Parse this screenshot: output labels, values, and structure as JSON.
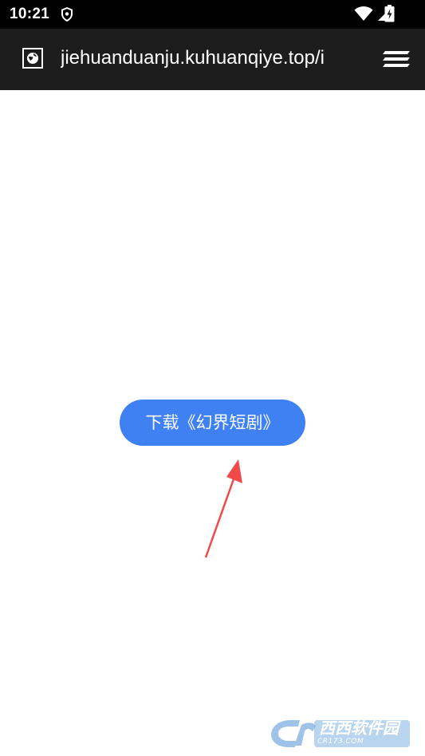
{
  "status_bar": {
    "time": "10:21",
    "icons": [
      "shield-icon",
      "wifi-icon",
      "signal-icon",
      "battery-charging-icon"
    ]
  },
  "browser": {
    "url": "jiehuanduanju.kuhuanqiye.top/i",
    "site_icon": "globe-icon",
    "menu_icon": "menu-icon"
  },
  "main": {
    "download_button_label": "下载《幻界短剧》",
    "annotation_arrow_color": "#f04a4a",
    "button_color": "#3f81f2"
  },
  "watermark": {
    "brand": "西西软件园",
    "domain": "CR173.COM"
  }
}
